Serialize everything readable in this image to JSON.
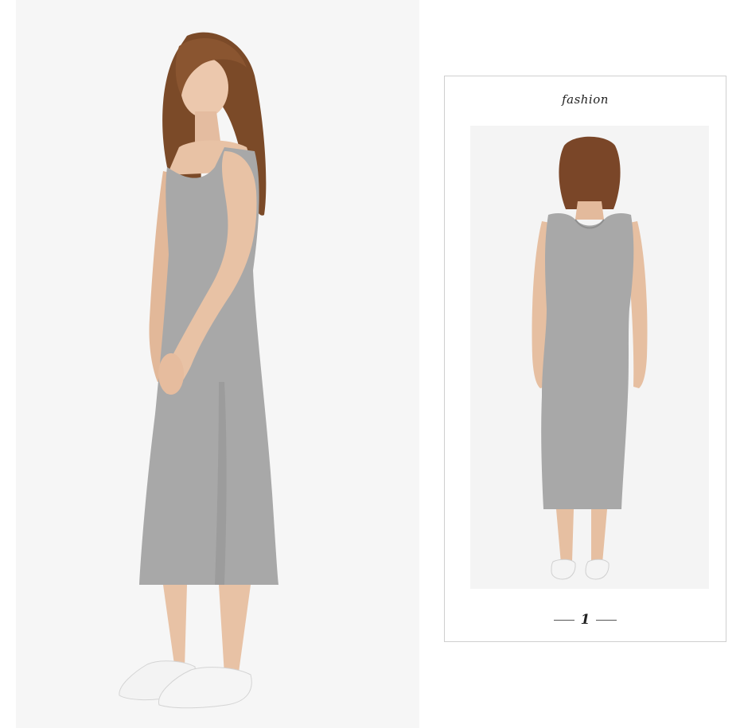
{
  "card": {
    "caption": "fashion",
    "page_number": "1"
  },
  "colors": {
    "background": "#ffffff",
    "photo_background": "#f6f6f6",
    "dress": "#a9a9a9",
    "hair": "#7a4a2a",
    "skin": "#e8c4a8",
    "shoes": "#f2f2f2",
    "card_border": "#cfcfcf"
  }
}
